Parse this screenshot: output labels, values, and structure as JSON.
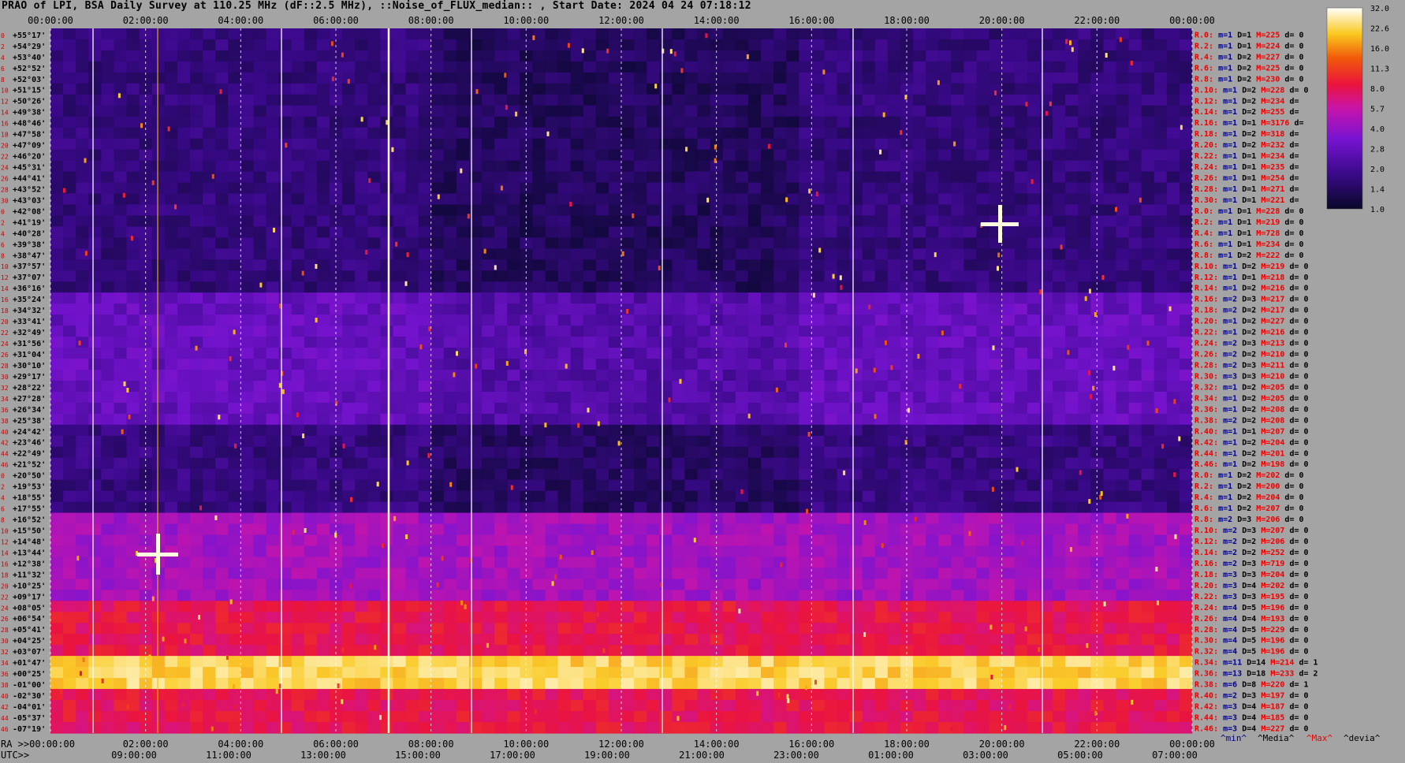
{
  "title": "PRAO of LPI, BSA Daily Survey at 110.25 MHz (dF::2.5 MHz), ::Noise_of_FLUX_median:: , Start Date: 2024 04 24 07:18:12",
  "chart_data": {
    "type": "heatmap",
    "top_time_ticks": [
      "00:00:00",
      "02:00:00",
      "04:00:00",
      "06:00:00",
      "08:00:00",
      "10:00:00",
      "12:00:00",
      "14:00:00",
      "16:00:00",
      "18:00:00",
      "20:00:00",
      "22:00:00",
      "00:00:00"
    ],
    "ra_label": "RA >>00:00:00",
    "ra_ticks": [
      "02:00:00",
      "04:00:00",
      "06:00:00",
      "08:00:00",
      "10:00:00",
      "12:00:00",
      "14:00:00",
      "16:00:00",
      "18:00:00",
      "20:00:00",
      "22:00:00",
      "00:00:00"
    ],
    "utc_label": "UTC>>",
    "utc_ticks": [
      "09:00:00",
      "11:00:00",
      "13:00:00",
      "15:00:00",
      "17:00:00",
      "19:00:00",
      "21:00:00",
      "23:00:00",
      "01:00:00",
      "03:00:00",
      "05:00:00",
      "07:00:00"
    ],
    "declinations": [
      "+55°17'",
      "+54°29'",
      "+53°40'",
      "+52°52'",
      "+52°03'",
      "+51°15'",
      "+50°26'",
      "+49°38'",
      "+48°46'",
      "+47°58'",
      "+47°09'",
      "+46°20'",
      "+45°31'",
      "+44°41'",
      "+43°52'",
      "+43°03'",
      "+42°08'",
      "+41°19'",
      "+40°28'",
      "+39°38'",
      "+38°47'",
      "+37°57'",
      "+37°07'",
      "+36°16'",
      "+35°24'",
      "+34°32'",
      "+33°41'",
      "+32°49'",
      "+31°56'",
      "+31°04'",
      "+30°10'",
      "+29°17'",
      "+28°22'",
      "+27°28'",
      "+26°34'",
      "+25°38'",
      "+24°42'",
      "+23°46'",
      "+22°49'",
      "+21°52'",
      "+20°50'",
      "+19°53'",
      "+18°55'",
      "+17°55'",
      "+16°52'",
      "+15°50'",
      "+14°48'",
      "+13°44'",
      "+12°38'",
      "+11°32'",
      "+10°25'",
      "+09°17'",
      "+08°05'",
      "+06°54'",
      "+05°41'",
      "+04°25'",
      "+03°07'",
      "+01°47'",
      "+00°25'",
      "-01°00'",
      "-02°30'",
      "-04°01'",
      "-05°37'",
      "-07°19'"
    ],
    "beam_indices": [
      "0",
      "2",
      "4",
      "6",
      "8",
      "10",
      "12",
      "14",
      "16",
      "18",
      "20",
      "22",
      "24",
      "26",
      "28",
      "30",
      "0",
      "2",
      "4",
      "6",
      "8",
      "10",
      "12",
      "14",
      "16",
      "18",
      "20",
      "22",
      "24",
      "26",
      "28",
      "30",
      "32",
      "34",
      "36",
      "38",
      "40",
      "42",
      "44",
      "46",
      "0",
      "2",
      "4",
      "6",
      "8",
      "10",
      "12",
      "14",
      "16",
      "18",
      "20",
      "22",
      "24",
      "26",
      "28",
      "30",
      "32",
      "34",
      "36",
      "38",
      "40",
      "42",
      "44",
      "46"
    ],
    "right_stats": [
      {
        "r": "R.0:",
        "m": "m=1",
        "D": "D=1",
        "M": "M=225",
        "d": "d= 0"
      },
      {
        "r": "R.2:",
        "m": "m=1",
        "D": "D=1",
        "M": "M=224",
        "d": "d= 0"
      },
      {
        "r": "R.4:",
        "m": "m=1",
        "D": "D=2",
        "M": "M=227",
        "d": "d= 0"
      },
      {
        "r": "R.6:",
        "m": "m=1",
        "D": "D=2",
        "M": "M=225",
        "d": "d= 0"
      },
      {
        "r": "R.8:",
        "m": "m=1",
        "D": "D=2",
        "M": "M=230",
        "d": "d= 0"
      },
      {
        "r": "R.10:",
        "m": "m=1",
        "D": "D=2",
        "M": "M=228",
        "d": "d= 0"
      },
      {
        "r": "R.12:",
        "m": "m=1",
        "D": "D=2",
        "M": "M=234",
        "d": "d="
      },
      {
        "r": "R.14:",
        "m": "m=1",
        "D": "D=2",
        "M": "M=255",
        "d": "d="
      },
      {
        "r": "R.16:",
        "m": "m=1",
        "D": "D=1",
        "M": "M=3176",
        "d": "d="
      },
      {
        "r": "R.18:",
        "m": "m=1",
        "D": "D=2",
        "M": "M=318",
        "d": "d="
      },
      {
        "r": "R.20:",
        "m": "m=1",
        "D": "D=2",
        "M": "M=232",
        "d": "d="
      },
      {
        "r": "R.22:",
        "m": "m=1",
        "D": "D=1",
        "M": "M=234",
        "d": "d="
      },
      {
        "r": "R.24:",
        "m": "m=1",
        "D": "D=1",
        "M": "M=235",
        "d": "d="
      },
      {
        "r": "R.26:",
        "m": "m=1",
        "D": "D=1",
        "M": "M=254",
        "d": "d="
      },
      {
        "r": "R.28:",
        "m": "m=1",
        "D": "D=1",
        "M": "M=271",
        "d": "d="
      },
      {
        "r": "R.30:",
        "m": "m=1",
        "D": "D=1",
        "M": "M=221",
        "d": "d="
      },
      {
        "r": "R.0:",
        "m": "m=1",
        "D": "D=1",
        "M": "M=228",
        "d": "d= 0"
      },
      {
        "r": "R.2:",
        "m": "m=1",
        "D": "D=1",
        "M": "M=219",
        "d": "d= 0"
      },
      {
        "r": "R.4:",
        "m": "m=1",
        "D": "D=1",
        "M": "M=728",
        "d": "d= 0"
      },
      {
        "r": "R.6:",
        "m": "m=1",
        "D": "D=1",
        "M": "M=234",
        "d": "d= 0"
      },
      {
        "r": "R.8:",
        "m": "m=1",
        "D": "D=2",
        "M": "M=222",
        "d": "d= 0"
      },
      {
        "r": "R.10:",
        "m": "m=1",
        "D": "D=2",
        "M": "M=219",
        "d": "d= 0"
      },
      {
        "r": "R.12:",
        "m": "m=1",
        "D": "D=1",
        "M": "M=218",
        "d": "d= 0"
      },
      {
        "r": "R.14:",
        "m": "m=1",
        "D": "D=2",
        "M": "M=216",
        "d": "d= 0"
      },
      {
        "r": "R.16:",
        "m": "m=2",
        "D": "D=3",
        "M": "M=217",
        "d": "d= 0"
      },
      {
        "r": "R.18:",
        "m": "m=2",
        "D": "D=2",
        "M": "M=217",
        "d": "d= 0"
      },
      {
        "r": "R.20:",
        "m": "m=1",
        "D": "D=2",
        "M": "M=227",
        "d": "d= 0"
      },
      {
        "r": "R.22:",
        "m": "m=1",
        "D": "D=2",
        "M": "M=216",
        "d": "d= 0"
      },
      {
        "r": "R.24:",
        "m": "m=2",
        "D": "D=3",
        "M": "M=213",
        "d": "d= 0"
      },
      {
        "r": "R.26:",
        "m": "m=2",
        "D": "D=2",
        "M": "M=210",
        "d": "d= 0"
      },
      {
        "r": "R.28:",
        "m": "m=2",
        "D": "D=3",
        "M": "M=211",
        "d": "d= 0"
      },
      {
        "r": "R.30:",
        "m": "m=3",
        "D": "D=3",
        "M": "M=210",
        "d": "d= 0"
      },
      {
        "r": "R.32:",
        "m": "m=1",
        "D": "D=2",
        "M": "M=205",
        "d": "d= 0"
      },
      {
        "r": "R.34:",
        "m": "m=1",
        "D": "D=2",
        "M": "M=205",
        "d": "d= 0"
      },
      {
        "r": "R.36:",
        "m": "m=1",
        "D": "D=2",
        "M": "M=208",
        "d": "d= 0"
      },
      {
        "r": "R.38:",
        "m": "m=2",
        "D": "D=2",
        "M": "M=208",
        "d": "d= 0"
      },
      {
        "r": "R.40:",
        "m": "m=1",
        "D": "D=1",
        "M": "M=207",
        "d": "d= 0"
      },
      {
        "r": "R.42:",
        "m": "m=1",
        "D": "D=2",
        "M": "M=204",
        "d": "d= 0"
      },
      {
        "r": "R.44:",
        "m": "m=1",
        "D": "D=2",
        "M": "M=201",
        "d": "d= 0"
      },
      {
        "r": "R.46:",
        "m": "m=1",
        "D": "D=2",
        "M": "M=198",
        "d": "d= 0"
      },
      {
        "r": "R.0:",
        "m": "m=1",
        "D": "D=2",
        "M": "M=202",
        "d": "d= 0"
      },
      {
        "r": "R.2:",
        "m": "m=1",
        "D": "D=2",
        "M": "M=200",
        "d": "d= 0"
      },
      {
        "r": "R.4:",
        "m": "m=1",
        "D": "D=2",
        "M": "M=204",
        "d": "d= 0"
      },
      {
        "r": "R.6:",
        "m": "m=1",
        "D": "D=2",
        "M": "M=207",
        "d": "d= 0"
      },
      {
        "r": "R.8:",
        "m": "m=2",
        "D": "D=3",
        "M": "M=206",
        "d": "d= 0"
      },
      {
        "r": "R.10:",
        "m": "m=2",
        "D": "D=3",
        "M": "M=207",
        "d": "d= 0"
      },
      {
        "r": "R.12:",
        "m": "m=2",
        "D": "D=2",
        "M": "M=206",
        "d": "d= 0"
      },
      {
        "r": "R.14:",
        "m": "m=2",
        "D": "D=2",
        "M": "M=252",
        "d": "d= 0"
      },
      {
        "r": "R.16:",
        "m": "m=2",
        "D": "D=3",
        "M": "M=719",
        "d": "d= 0"
      },
      {
        "r": "R.18:",
        "m": "m=3",
        "D": "D=3",
        "M": "M=204",
        "d": "d= 0"
      },
      {
        "r": "R.20:",
        "m": "m=3",
        "D": "D=4",
        "M": "M=202",
        "d": "d= 0"
      },
      {
        "r": "R.22:",
        "m": "m=3",
        "D": "D=3",
        "M": "M=195",
        "d": "d= 0"
      },
      {
        "r": "R.24:",
        "m": "m=4",
        "D": "D=5",
        "M": "M=196",
        "d": "d= 0"
      },
      {
        "r": "R.26:",
        "m": "m=4",
        "D": "D=4",
        "M": "M=193",
        "d": "d= 0"
      },
      {
        "r": "R.28:",
        "m": "m=4",
        "D": "D=5",
        "M": "M=229",
        "d": "d= 0"
      },
      {
        "r": "R.30:",
        "m": "m=4",
        "D": "D=5",
        "M": "M=196",
        "d": "d= 0"
      },
      {
        "r": "R.32:",
        "m": "m=4",
        "D": "D=5",
        "M": "M=196",
        "d": "d= 0"
      },
      {
        "r": "R.34:",
        "m": "m=11",
        "D": "D=14",
        "M": "M=214",
        "d": "d= 1"
      },
      {
        "r": "R.36:",
        "m": "m=13",
        "D": "D=18",
        "M": "M=233",
        "d": "d= 2"
      },
      {
        "r": "R.38:",
        "m": "m=6",
        "D": "D=8",
        "M": "M=220",
        "d": "d= 1"
      },
      {
        "r": "R.40:",
        "m": "m=2",
        "D": "D=3",
        "M": "M=197",
        "d": "d= 0"
      },
      {
        "r": "R.42:",
        "m": "m=3",
        "D": "D=4",
        "M": "M=187",
        "d": "d= 0"
      },
      {
        "r": "R.44:",
        "m": "m=3",
        "D": "D=4",
        "M": "M=185",
        "d": "d= 0"
      },
      {
        "r": "R.46:",
        "m": "m=3",
        "D": "D=4",
        "M": "M=227",
        "d": "d= 0"
      }
    ],
    "stat_legend": {
      "min": "^min^",
      "median": "^Media^",
      "max": "^Max^",
      "devia": "^devia^"
    },
    "colorbar_ticks": [
      "32.0",
      "22.6",
      "16.0",
      "11.3",
      "8.0",
      "5.7",
      "4.0",
      "2.8",
      "2.0",
      "1.4",
      "1.0"
    ],
    "colors": {
      "background": "#a4a4a4",
      "r_label": "#ee0000",
      "m_label": "#000088",
      "M_label": "#ee0000",
      "white_line": "#ffffff"
    }
  }
}
